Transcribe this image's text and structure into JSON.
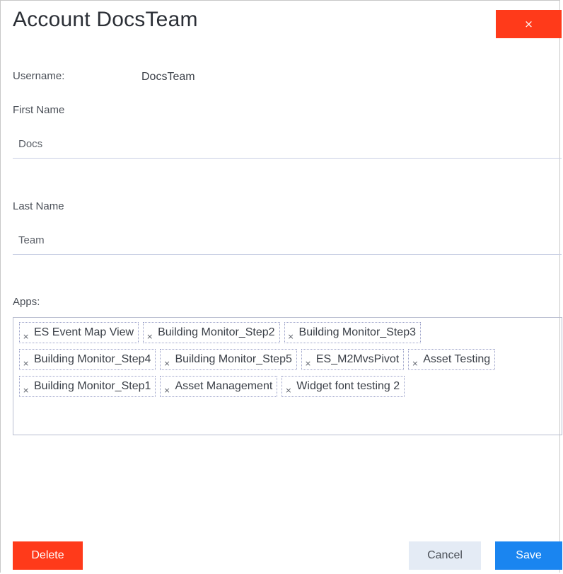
{
  "dialog": {
    "title": "Account DocsTeam",
    "close_label": "×"
  },
  "username": {
    "label": "Username:",
    "value": "DocsTeam"
  },
  "first_name": {
    "label": "First Name",
    "value": "Docs"
  },
  "last_name": {
    "label": "Last Name",
    "value": "Team"
  },
  "apps": {
    "label": "Apps:",
    "remove_glyph": "×",
    "items": [
      "ES Event Map View",
      "Building Monitor_Step2",
      "Building Monitor_Step3",
      "Building Monitor_Step4",
      "Building Monitor_Step5",
      "ES_M2MvsPivot",
      "Asset Testing",
      "Building Monitor_Step1",
      "Asset Management",
      "Widget font testing 2"
    ]
  },
  "actions": {
    "delete_label": "Delete",
    "cancel_label": "Cancel",
    "save_label": "Save"
  },
  "colors": {
    "danger": "#ff3a1a",
    "primary": "#1a85f0",
    "secondary": "#e4ebf5"
  }
}
